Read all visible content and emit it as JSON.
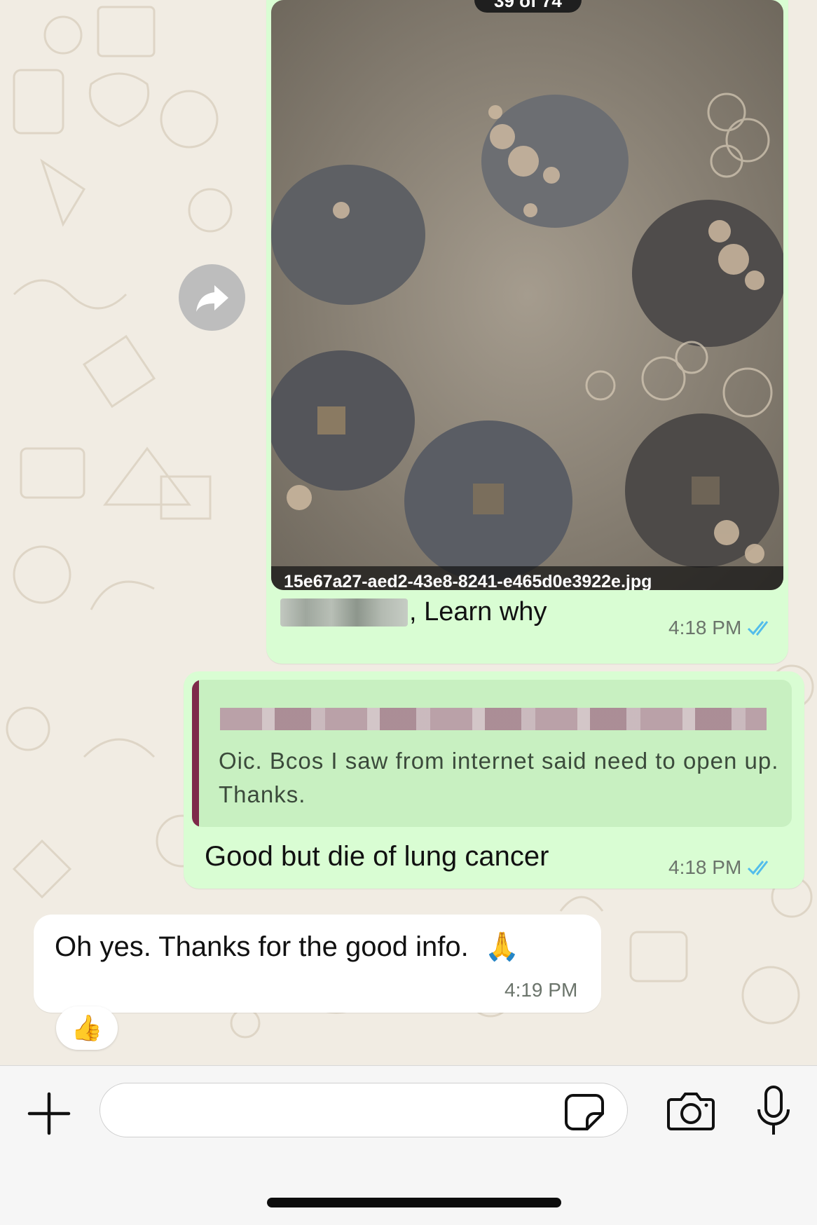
{
  "image_message": {
    "counter": "39 of 74",
    "filename": "15e67a27-aed2-43e8-8241-e465d0e3922e.jpg",
    "caption_suffix": ", Learn why",
    "time": "4:18 PM",
    "status": "read"
  },
  "reply_message": {
    "quoted_text": "Oic. Bcos I saw from internet said need to open up. Thanks.",
    "text": "Good but die of lung cancer",
    "time": "4:18 PM",
    "status": "read"
  },
  "incoming_message": {
    "text": "Oh yes. Thanks for the good info.",
    "emoji": "🙏",
    "time": "4:19 PM",
    "reaction": "👍"
  },
  "composer": {
    "value": "",
    "placeholder": ""
  },
  "colors": {
    "outgoing_bubble": "#d9fdd3",
    "incoming_bubble": "#ffffff",
    "read_ticks": "#53bdeb",
    "quote_bar": "#7e2a4a"
  },
  "icons": {
    "forward": "forward-icon",
    "attach": "plus-icon",
    "sticker": "sticker-icon",
    "camera": "camera-icon",
    "mic": "mic-icon"
  }
}
